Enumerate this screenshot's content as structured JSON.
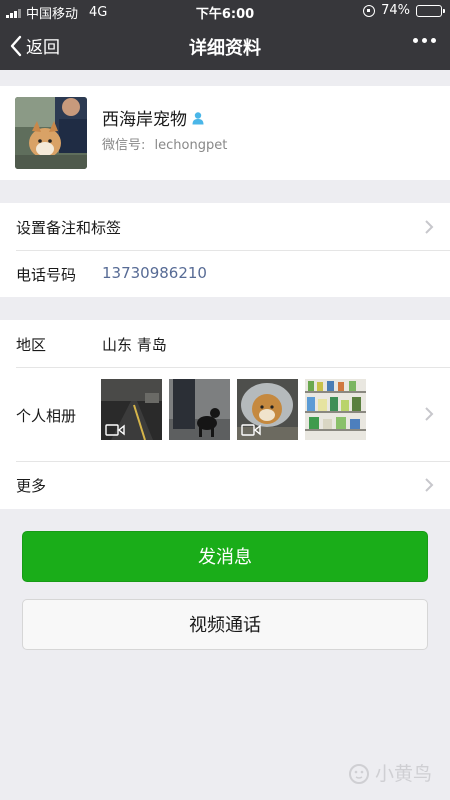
{
  "status_bar": {
    "carrier": "中国移动",
    "network": "4G",
    "time": "下午6:00",
    "battery": "74%",
    "battery_level": 0.74
  },
  "nav": {
    "back_label": "返回",
    "title": "详细资料",
    "more_icon": "more-dots-icon"
  },
  "profile": {
    "name": "西海岸宠物",
    "gender_icon": "male-user-icon",
    "wechat_id_label": "微信号:",
    "wechat_id": "lechongpet"
  },
  "rows": {
    "remark_label": "设置备注和标签",
    "phone_label": "电话号码",
    "phone_value": "13730986210",
    "region_label": "地区",
    "region_value": "山东 青岛",
    "album_label": "个人相册",
    "more_label": "更多"
  },
  "album_thumbs": [
    {
      "name": "album-photo-1",
      "video": true
    },
    {
      "name": "album-photo-2",
      "video": false
    },
    {
      "name": "album-photo-3",
      "video": true
    },
    {
      "name": "album-photo-4",
      "video": false
    }
  ],
  "buttons": {
    "send_message": "发消息",
    "video_call": "视频通话"
  },
  "watermark": "小黄鸟",
  "colors": {
    "nav_bg": "#37373b",
    "primary_green": "#1aad19",
    "link_blue": "#576b95",
    "page_bg": "#ededf1"
  }
}
